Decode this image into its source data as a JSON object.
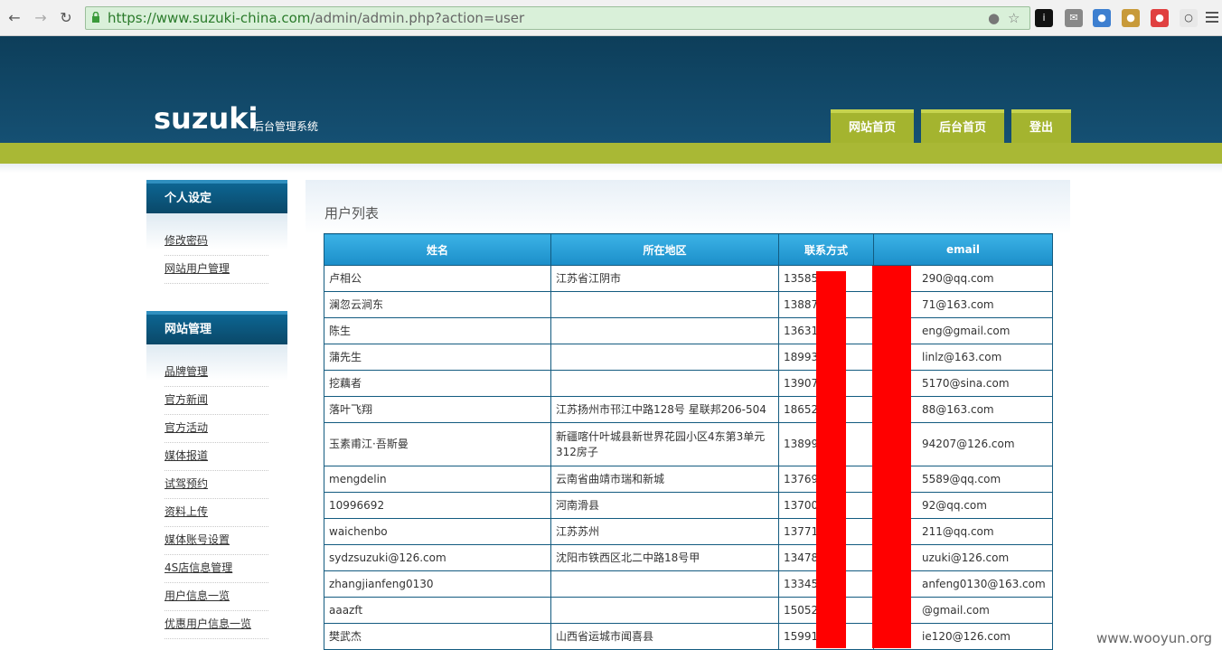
{
  "browser": {
    "url_secure": "https://www.suzuki-china.com",
    "url_path": "/admin/admin.php?action=user"
  },
  "header": {
    "logo": "suzuki",
    "subtitle": "后台管理系统",
    "nav": [
      "网站首页",
      "后台首页",
      "登出"
    ]
  },
  "sidebar": {
    "sections": [
      {
        "title": "个人设定",
        "items": [
          "修改密码",
          "网站用户管理"
        ]
      },
      {
        "title": "网站管理",
        "items": [
          "品牌管理",
          "官方新闻",
          "官方活动",
          "媒体报道",
          "试驾预约",
          "资料上传",
          "媒体账号设置",
          "4S店信息管理",
          "用户信息一览",
          "优惠用户信息一览"
        ]
      }
    ]
  },
  "content": {
    "title": "用户列表",
    "columns": [
      "姓名",
      "所在地区",
      "联系方式",
      "email"
    ],
    "rows": [
      [
        "卢相公",
        "江苏省江阴市",
        "1358547",
        "290@qq.com"
      ],
      [
        "澜忽云涧东",
        "",
        "1388721",
        "71@163.com"
      ],
      [
        "陈生",
        "",
        "1363145",
        "eng@gmail.com"
      ],
      [
        "蒲先生",
        "",
        "1899304",
        "linlz@163.com"
      ],
      [
        "挖藕者",
        "",
        "1390721",
        "5170@sina.com"
      ],
      [
        "落叶飞翔",
        "江苏扬州市邗江中路128号 星联邦206-504",
        "1865256",
        "88@163.com"
      ],
      [
        "玉素甫江·吾斯曼",
        "新疆喀什叶城县新世界花园小区4东第3单元312房子",
        "1389919",
        "94207@126.com"
      ],
      [
        "mengdelin",
        "云南省曲靖市瑞和新城",
        "1376978",
        "5589@qq.com"
      ],
      [
        "10996692",
        "河南滑县",
        "1370072",
        "92@qq.com"
      ],
      [
        "waichenbo",
        "江苏苏州",
        "1377179",
        "211@qq.com"
      ],
      [
        "sydzsuzuki@126.com",
        "沈阳市铁西区北二中路18号甲",
        "1347884",
        "uzuki@126.com"
      ],
      [
        "zhangjianfeng0130",
        "",
        "1334544",
        "anfeng0130@163.com"
      ],
      [
        "aaazft",
        "",
        "1505221",
        "@gmail.com"
      ],
      [
        "樊武杰",
        "山西省运城市闻喜县",
        "1599138",
        "ie120@126.com"
      ]
    ]
  },
  "watermark": "www.wooyun.org",
  "colors": {
    "header_bg": "#0d3e5a",
    "accent_green": "#a9b835",
    "table_header": "#2aa0d8",
    "redaction": "#ff0000"
  }
}
